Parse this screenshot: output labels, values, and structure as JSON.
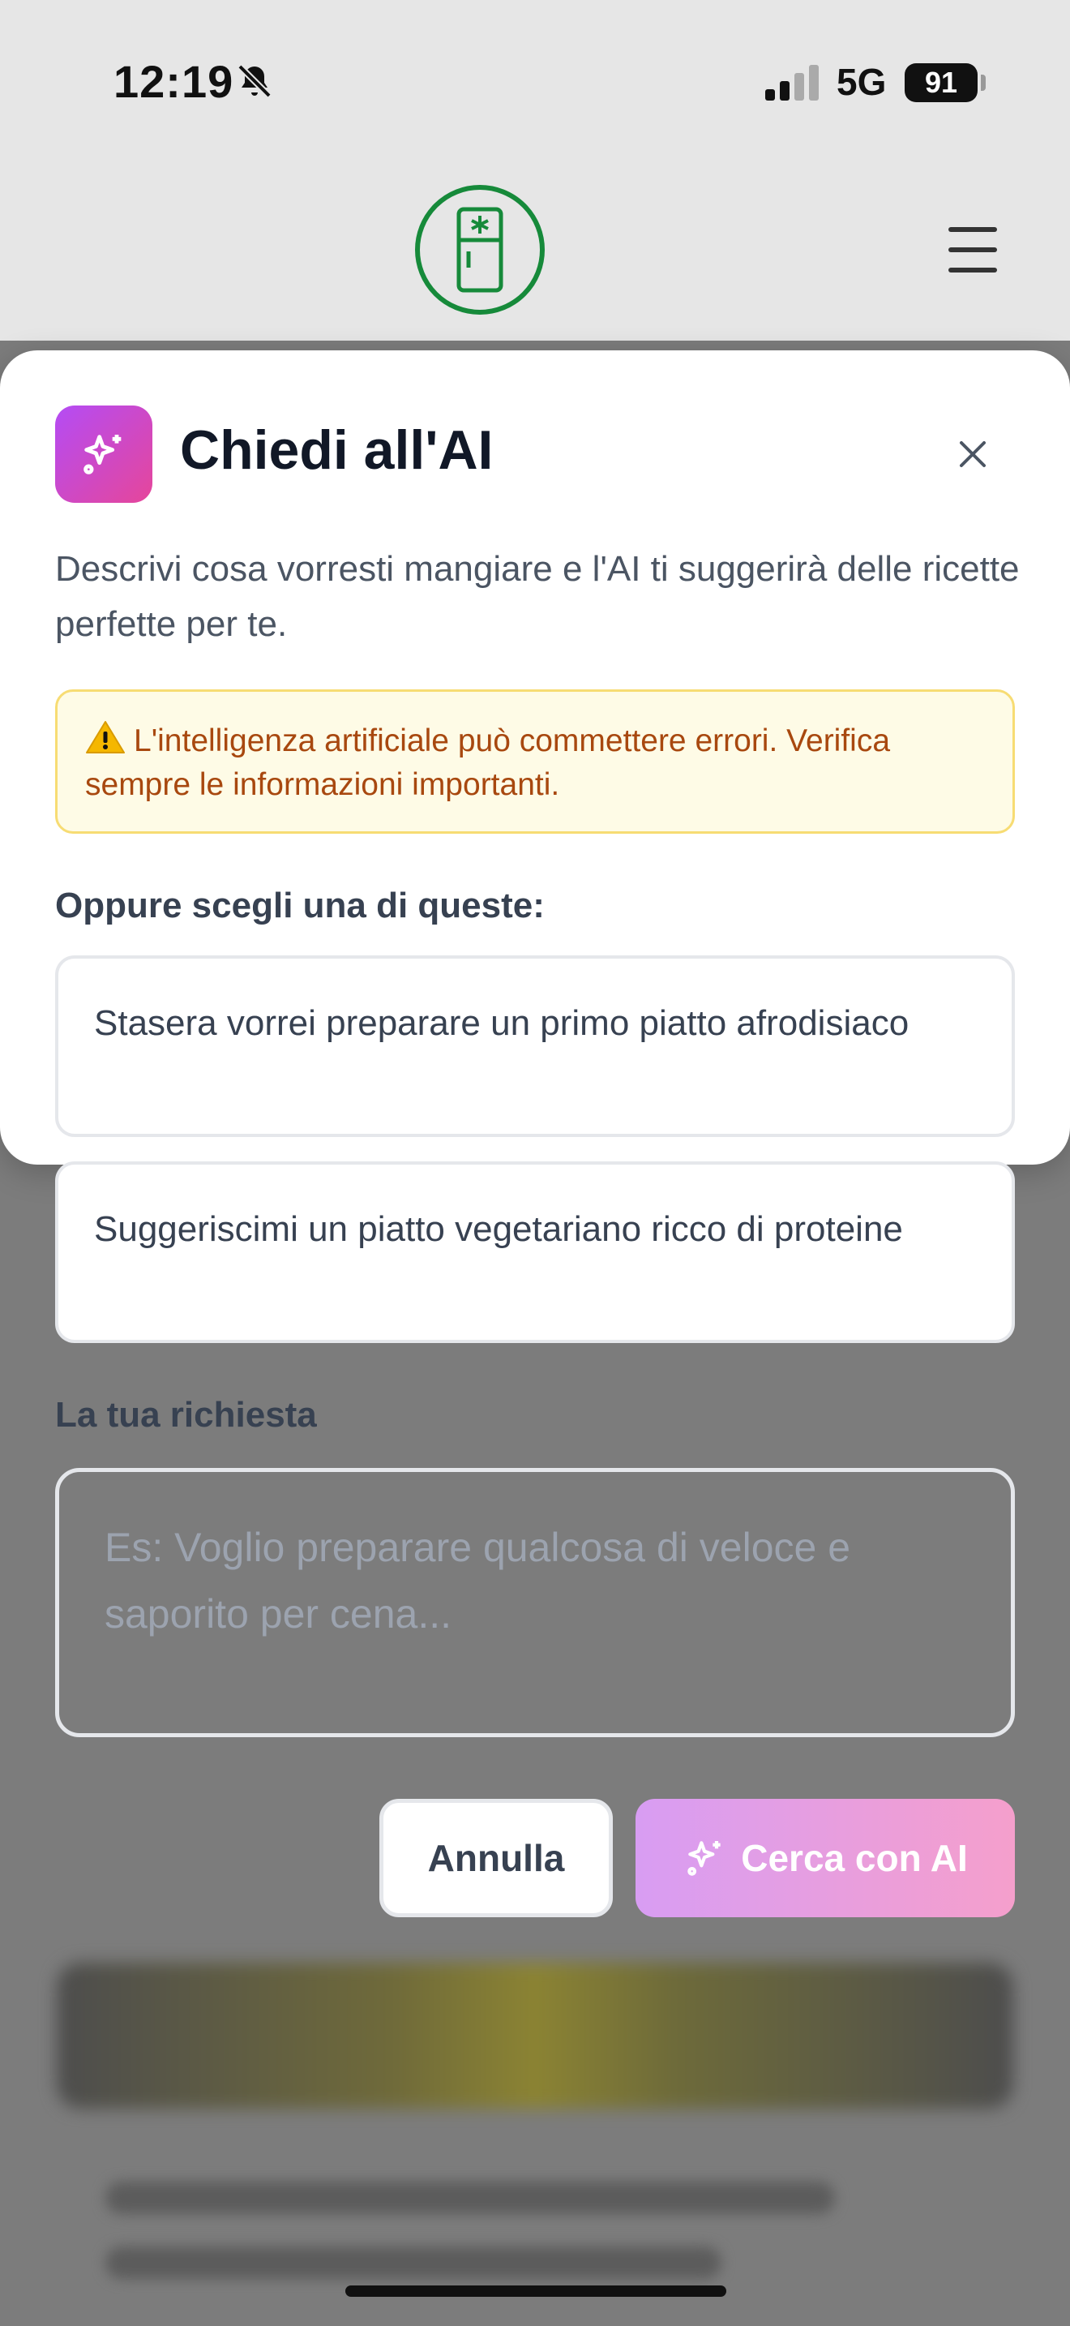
{
  "status_bar": {
    "time": "12:19",
    "network": "5G",
    "battery": "91"
  },
  "header": {
    "logo_icon": "fridge-icon",
    "menu_icon": "hamburger-menu-icon",
    "brand_color": "#168a3a"
  },
  "modal": {
    "icon": "sparkles-icon",
    "title": "Chiedi all'AI",
    "description": "Descrivi cosa vorresti mangiare e l'AI ti suggerirà delle ricette perfette per te.",
    "warning": "L'intelligenza artificiale può commettere errori. Verifica sempre le informazioni importanti.",
    "suggestions_label": "Oppure scegli una di queste:",
    "suggestions": [
      "Stasera vorrei preparare un primo piatto afrodisiaco",
      "Suggeriscimi un piatto vegetariano ricco di proteine"
    ],
    "request_label": "La tua richiesta",
    "request_placeholder": "Es: Voglio preparare qualcosa di veloce e saporito per cena...",
    "request_value": "",
    "cancel_label": "Annulla",
    "search_label": "Cerca con AI",
    "accent_gradient": [
      "#b44cf5",
      "#e6469a"
    ]
  }
}
